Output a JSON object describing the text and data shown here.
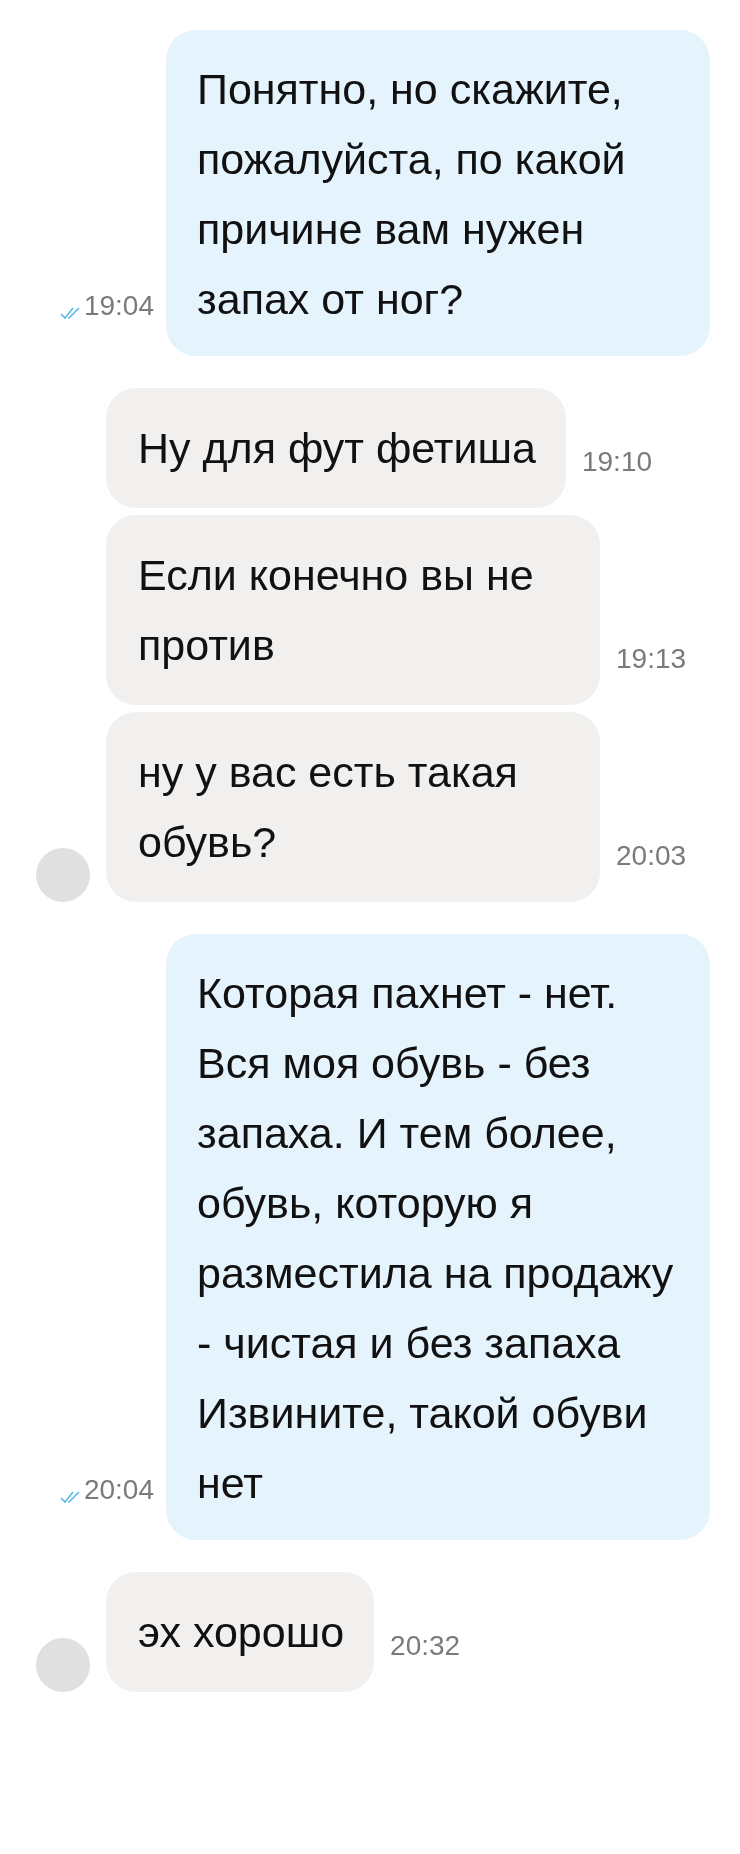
{
  "messages": [
    {
      "kind": "out",
      "text": "Понятно, но скажите, пожалуйста, по какой причине вам нужен запах от ног?",
      "time": "19:04",
      "read": true
    },
    {
      "kind": "in",
      "text": "Ну для фут фетиша",
      "time": "19:10",
      "avatar": false
    },
    {
      "kind": "in",
      "text": "Если конечно вы не против",
      "time": "19:13",
      "avatar": false
    },
    {
      "kind": "in",
      "text": "ну у вас есть такая обувь?",
      "time": "20:03",
      "avatar": true
    },
    {
      "kind": "out",
      "text": "Которая пахнет - нет. Вся моя обувь - без запаха. И тем более, обувь, которую я разместила на продажу - чистая и без запаха\nИзвините, такой обуви нет",
      "time": "20:04",
      "read": true
    },
    {
      "kind": "in",
      "text": "эх хорошо",
      "time": "20:32",
      "avatar": true
    }
  ]
}
